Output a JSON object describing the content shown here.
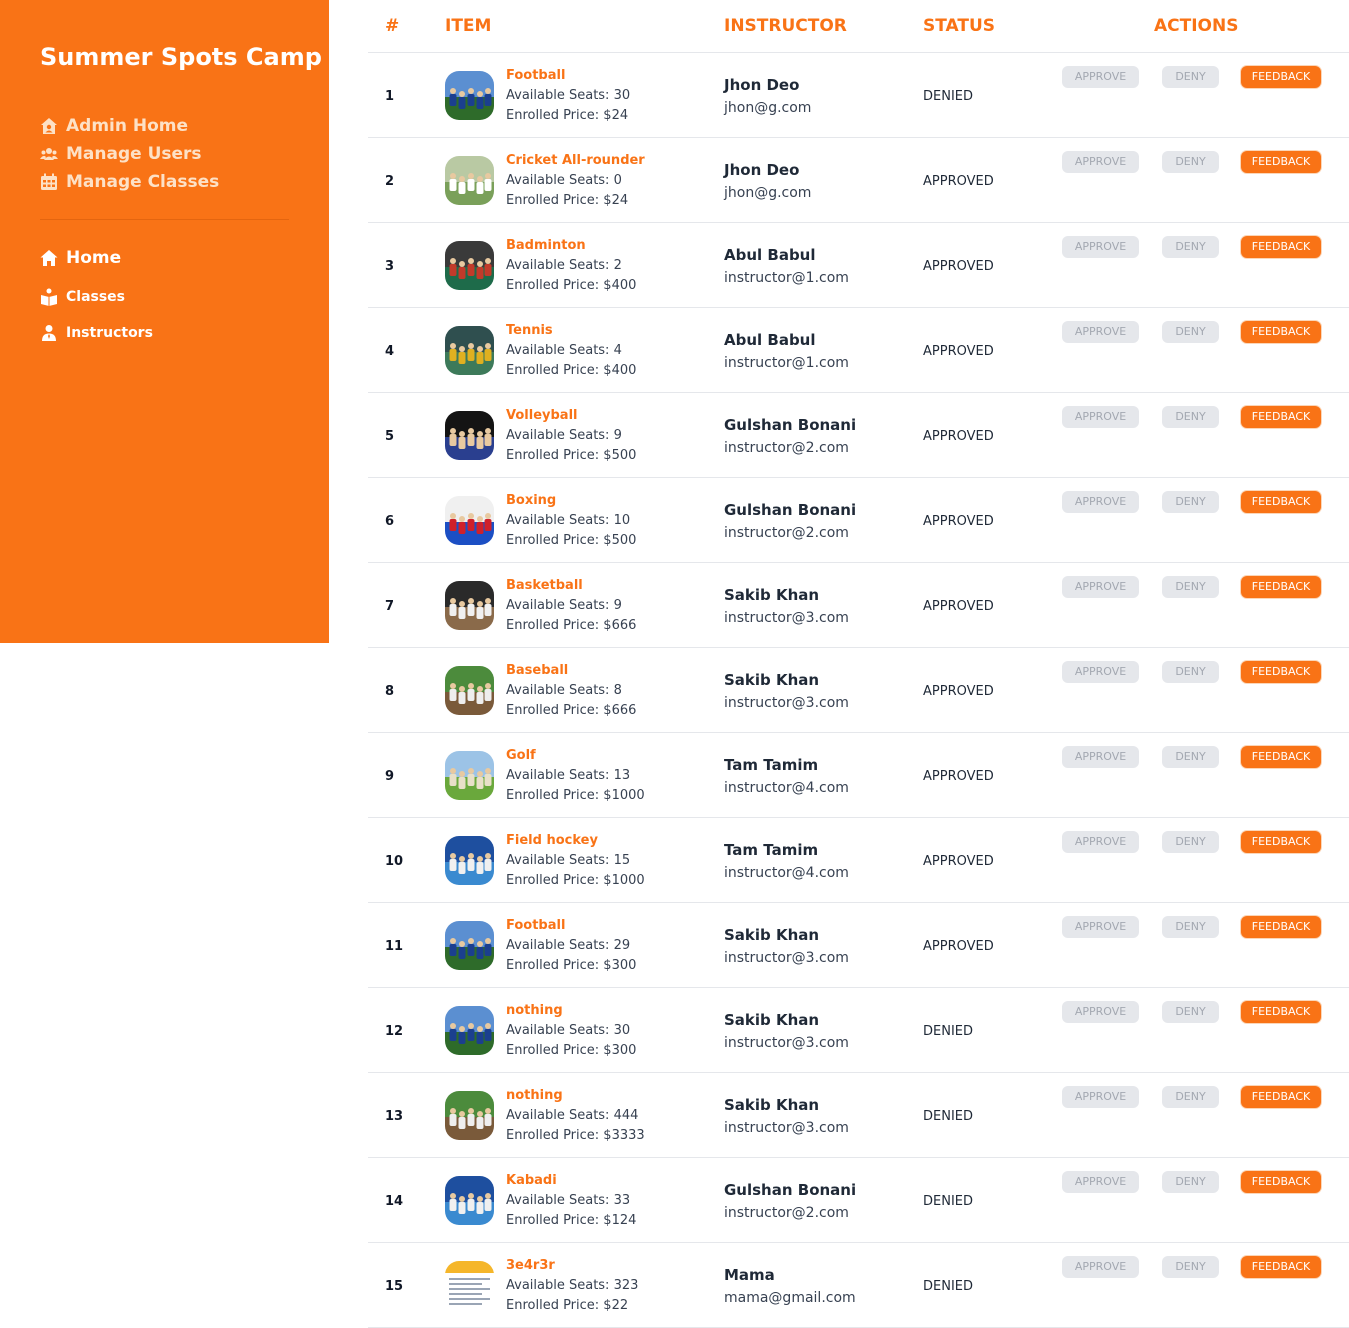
{
  "sidebar": {
    "brand": "Summer Spots Camp",
    "admin_items": [
      {
        "label": "Admin Home",
        "icon": "house-user-icon"
      },
      {
        "label": "Manage Users",
        "icon": "users-icon"
      },
      {
        "label": "Manage Classes",
        "icon": "calendar-icon"
      }
    ],
    "main_items": [
      {
        "label": "Home",
        "icon": "home-icon"
      },
      {
        "label": "Classes",
        "icon": "classes-icon"
      },
      {
        "label": "Instructors",
        "icon": "instructor-icon"
      }
    ]
  },
  "table": {
    "headers": [
      "#",
      "ITEM",
      "INSTRUCTOR",
      "STATUS",
      "ACTIONS"
    ],
    "buttons": {
      "approve": "APPROVE",
      "deny": "DENY",
      "feedback": "FEEDBACK"
    },
    "seats_prefix": "Available Seats: ",
    "price_prefix": "Enrolled Price: $",
    "rows": [
      {
        "num": "1",
        "name": "Football",
        "seats": "30",
        "price": "24",
        "instructor": "Jhon Deo",
        "email": "jhon@g.com",
        "status": "DENIED",
        "image": "football-team-thumbnail"
      },
      {
        "num": "2",
        "name": "Cricket All-rounder",
        "seats": "0",
        "price": "24",
        "instructor": "Jhon Deo",
        "email": "jhon@g.com",
        "status": "APPROVED",
        "image": "cricket-thumbnail"
      },
      {
        "num": "3",
        "name": "Badminton",
        "seats": "2",
        "price": "400",
        "instructor": "Abul Babul",
        "email": "instructor@1.com",
        "status": "APPROVED",
        "image": "badminton-thumbnail"
      },
      {
        "num": "4",
        "name": "Tennis",
        "seats": "4",
        "price": "400",
        "instructor": "Abul Babul",
        "email": "instructor@1.com",
        "status": "APPROVED",
        "image": "tennis-thumbnail"
      },
      {
        "num": "5",
        "name": "Volleyball",
        "seats": "9",
        "price": "500",
        "instructor": "Gulshan Bonani",
        "email": "instructor@2.com",
        "status": "APPROVED",
        "image": "volleyball-thumbnail"
      },
      {
        "num": "6",
        "name": "Boxing",
        "seats": "10",
        "price": "500",
        "instructor": "Gulshan Bonani",
        "email": "instructor@2.com",
        "status": "APPROVED",
        "image": "boxing-thumbnail"
      },
      {
        "num": "7",
        "name": "Basketball",
        "seats": "9",
        "price": "666",
        "instructor": "Sakib Khan",
        "email": "instructor@3.com",
        "status": "APPROVED",
        "image": "basketball-thumbnail"
      },
      {
        "num": "8",
        "name": "Baseball",
        "seats": "8",
        "price": "666",
        "instructor": "Sakib Khan",
        "email": "instructor@3.com",
        "status": "APPROVED",
        "image": "baseball-thumbnail"
      },
      {
        "num": "9",
        "name": "Golf",
        "seats": "13",
        "price": "1000",
        "instructor": "Tam Tamim",
        "email": "instructor@4.com",
        "status": "APPROVED",
        "image": "golf-thumbnail"
      },
      {
        "num": "10",
        "name": "Field hockey",
        "seats": "15",
        "price": "1000",
        "instructor": "Tam Tamim",
        "email": "instructor@4.com",
        "status": "APPROVED",
        "image": "field-hockey-thumbnail"
      },
      {
        "num": "11",
        "name": "Football",
        "seats": "29",
        "price": "300",
        "instructor": "Sakib Khan",
        "email": "instructor@3.com",
        "status": "APPROVED",
        "image": "football-team-thumbnail"
      },
      {
        "num": "12",
        "name": "nothing",
        "seats": "30",
        "price": "300",
        "instructor": "Sakib Khan",
        "email": "instructor@3.com",
        "status": "DENIED",
        "image": "football-team-thumbnail"
      },
      {
        "num": "13",
        "name": "nothing",
        "seats": "444",
        "price": "3333",
        "instructor": "Sakib Khan",
        "email": "instructor@3.com",
        "status": "DENIED",
        "image": "baseball-thumbnail"
      },
      {
        "num": "14",
        "name": "Kabadi",
        "seats": "33",
        "price": "124",
        "instructor": "Gulshan Bonani",
        "email": "instructor@2.com",
        "status": "DENIED",
        "image": "field-hockey-thumbnail"
      },
      {
        "num": "15",
        "name": "3e4r3r",
        "seats": "323",
        "price": "22",
        "instructor": "Mama",
        "email": "mama@gmail.com",
        "status": "DENIED",
        "image": "document-screenshot-thumbnail"
      }
    ]
  }
}
